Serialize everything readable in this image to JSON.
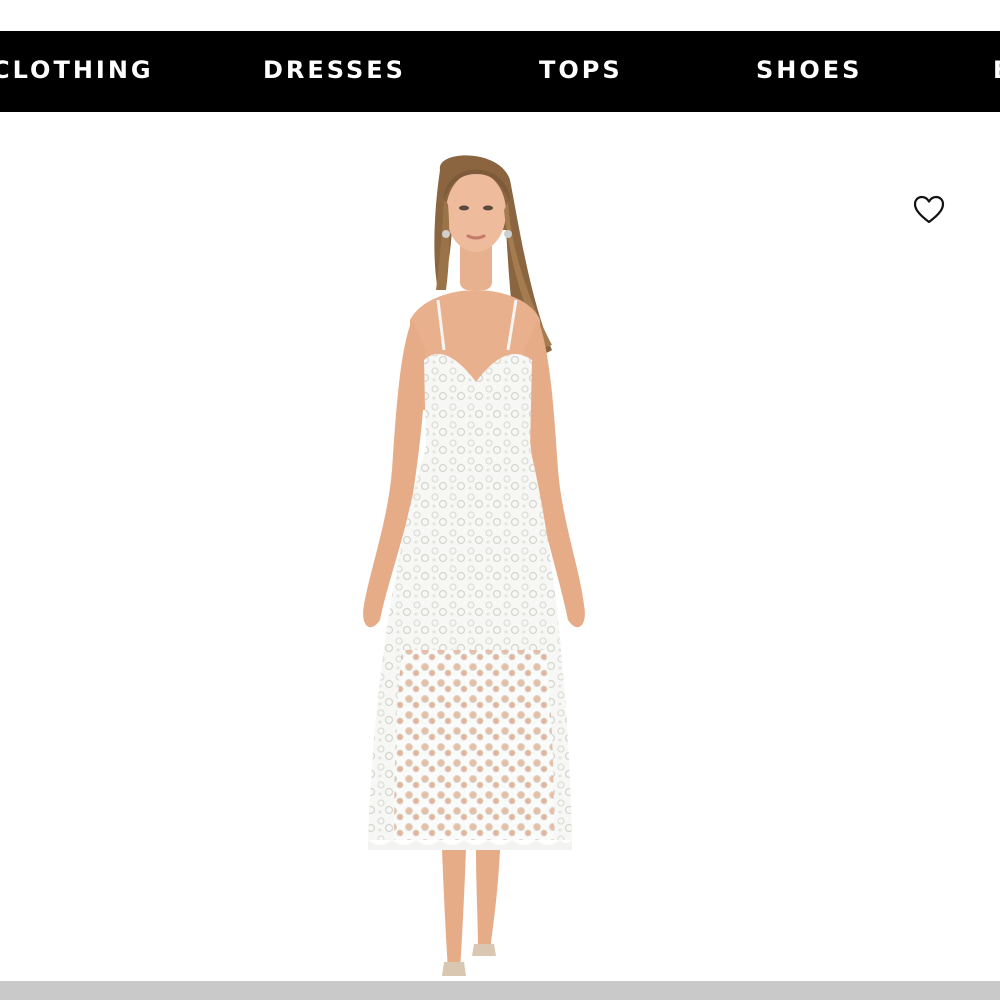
{
  "nav": {
    "items": [
      {
        "label": "CLOTHING"
      },
      {
        "label": "DRESSES"
      },
      {
        "label": "TOPS"
      },
      {
        "label": "SHOES"
      },
      {
        "label": "B"
      }
    ]
  },
  "product": {
    "wishlist_icon": "heart-outline-icon",
    "image_icon": "model-white-lace-midi-dress"
  },
  "colors": {
    "nav_background": "#000000",
    "nav_text": "#ffffff",
    "page_background": "#ffffff",
    "bottom_bar": "#c9c9c9"
  }
}
